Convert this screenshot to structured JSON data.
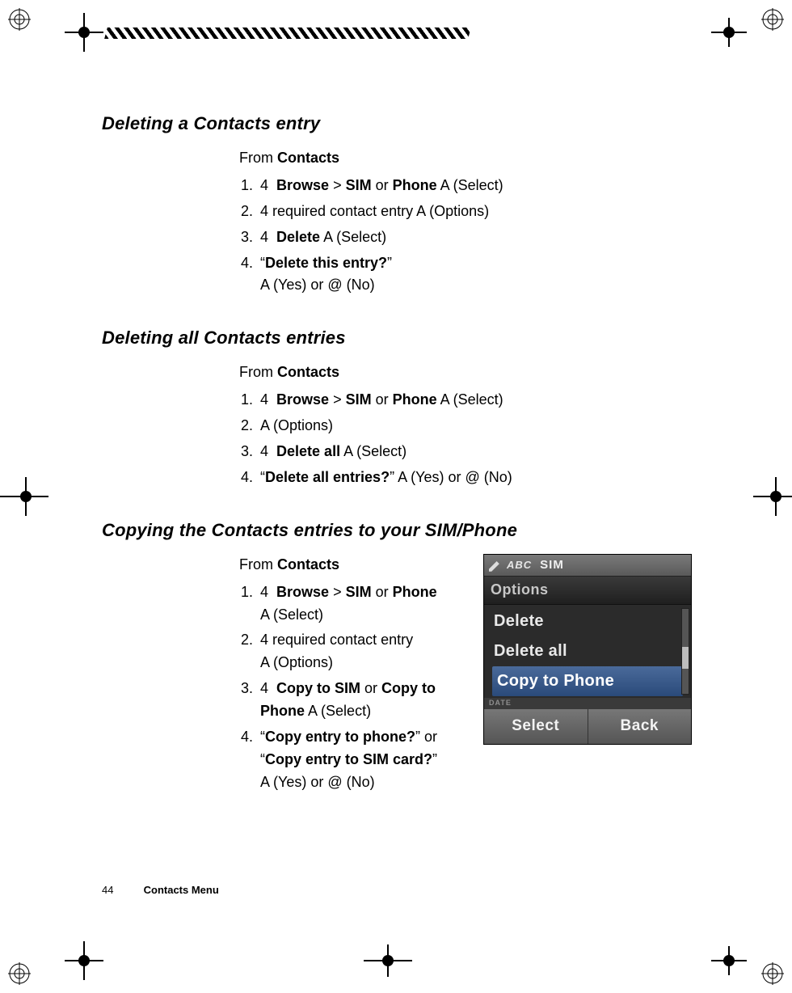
{
  "sections": {
    "delete_entry": {
      "heading": "Deleting a Contacts entry",
      "from_prefix": "From ",
      "from_bold": "Contacts",
      "steps": {
        "s1": {
          "nav": "4",
          "b1": "Browse",
          "gt": " > ",
          "b2": "SIM",
          "or": " or ",
          "b3": "Phone",
          "key": " A",
          "label": " (Select)"
        },
        "s2": {
          "nav": "4",
          "text": " required contact entry ",
          "key": "A",
          "label": " (Options)"
        },
        "s3": {
          "nav": "4",
          "b1": "Delete",
          "key": " A",
          "label": " (Select)"
        },
        "s4": {
          "q_open": "“",
          "q_bold": "Delete this entry?",
          "q_close": "”",
          "line2_key1": "A",
          "line2_yes": " (Yes) or ",
          "line2_key2": "@",
          "line2_no": " (No)"
        }
      }
    },
    "delete_all": {
      "heading": "Deleting all Contacts entries",
      "from_prefix": "From ",
      "from_bold": "Contacts",
      "steps": {
        "s1": {
          "nav": "4",
          "b1": "Browse",
          "gt": " > ",
          "b2": "SIM",
          "or": " or ",
          "b3": "Phone",
          "key": " A",
          "label": " (Select)"
        },
        "s2": {
          "key": "A",
          "label": " (Options)"
        },
        "s3": {
          "nav": "4",
          "b1": "Delete all",
          "key": " A",
          "label": " (Select)"
        },
        "s4": {
          "q_open": "“",
          "q_bold": "Delete all entries?",
          "q_close": "” ",
          "key1": "A",
          "yes": " (Yes) or ",
          "key2": "@",
          "no": " (No)"
        }
      }
    },
    "copy": {
      "heading": "Copying the Contacts entries to your SIM/Phone",
      "from_prefix": "From ",
      "from_bold": "Contacts",
      "steps": {
        "s1": {
          "nav": "4",
          "b1": "Browse",
          "gt": " > ",
          "b2": "SIM",
          "or": " or ",
          "b3": "Phone",
          "line2_key": "A",
          "line2_label": " (Select)"
        },
        "s2": {
          "nav": "4",
          "text": " required contact entry",
          "line2_key": "A",
          "line2_label": " (Options)"
        },
        "s3": {
          "nav": "4",
          "b1": "Copy to SIM",
          "or": " or ",
          "b2": "Copy to Phone",
          "key": " A",
          "label": " (Select)"
        },
        "s4": {
          "q1_open": "“",
          "q1_bold": "Copy entry to phone?",
          "q1_close": "” or",
          "q2_open": "“",
          "q2_bold": "Copy entry to SIM card?",
          "q2_close": "”",
          "line3_key1": "A",
          "line3_yes": " (Yes) or ",
          "line3_key2": "@",
          "line3_no": " (No)"
        }
      }
    }
  },
  "phone_screen": {
    "status_abc": "ABC",
    "status_sim": "SIM",
    "title": "Options",
    "items": [
      "Delete",
      "Delete all",
      "Copy to Phone"
    ],
    "selected_index": 2,
    "sub_left": "DATE",
    "sub_right": "",
    "soft_left": "Select",
    "soft_right": "Back"
  },
  "footer": {
    "page_number": "44",
    "title": "Contacts Menu"
  }
}
